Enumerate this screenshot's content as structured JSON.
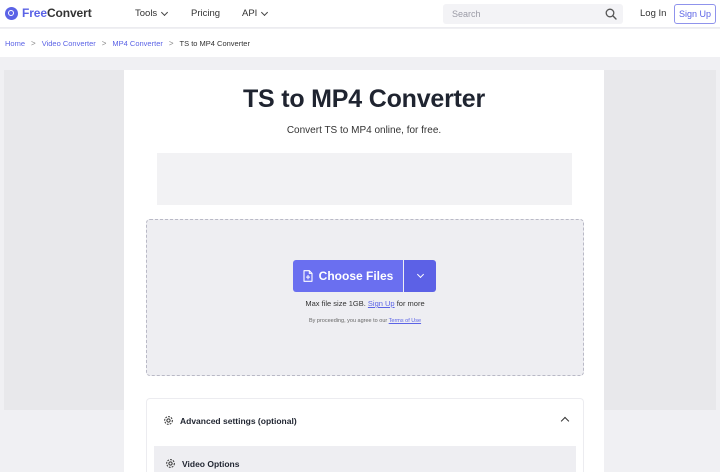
{
  "brand": {
    "name_prefix": "Free",
    "name_suffix": "Convert",
    "accent": "#5b63e6"
  },
  "nav": {
    "tools": "Tools",
    "pricing": "Pricing",
    "api": "API",
    "search_placeholder": "Search",
    "login": "Log In",
    "signup": "Sign Up"
  },
  "breadcrumb": {
    "items": [
      "Home",
      "Video Converter",
      "MP4 Converter"
    ],
    "current": "TS to MP4 Converter",
    "separator": ">"
  },
  "hero": {
    "title": "TS to MP4 Converter",
    "subtitle": "Convert TS to MP4 online, for free."
  },
  "upload": {
    "choose_label": "Choose Files",
    "max_size_prefix": "Max file size 1GB.",
    "max_size_link": "Sign Up",
    "max_size_suffix": "for more",
    "agree_prefix": "By proceeding, you agree to our",
    "terms_link": "Terms of Use"
  },
  "advanced": {
    "title": "Advanced settings (optional)",
    "video_options": "Video Options"
  },
  "icons": {
    "logo": "freeconvert-logo-icon",
    "search": "search-icon",
    "file": "file-icon",
    "dropdown": "chevron-down-icon",
    "settings": "gear-icon",
    "collapse": "chevron-up-icon"
  }
}
